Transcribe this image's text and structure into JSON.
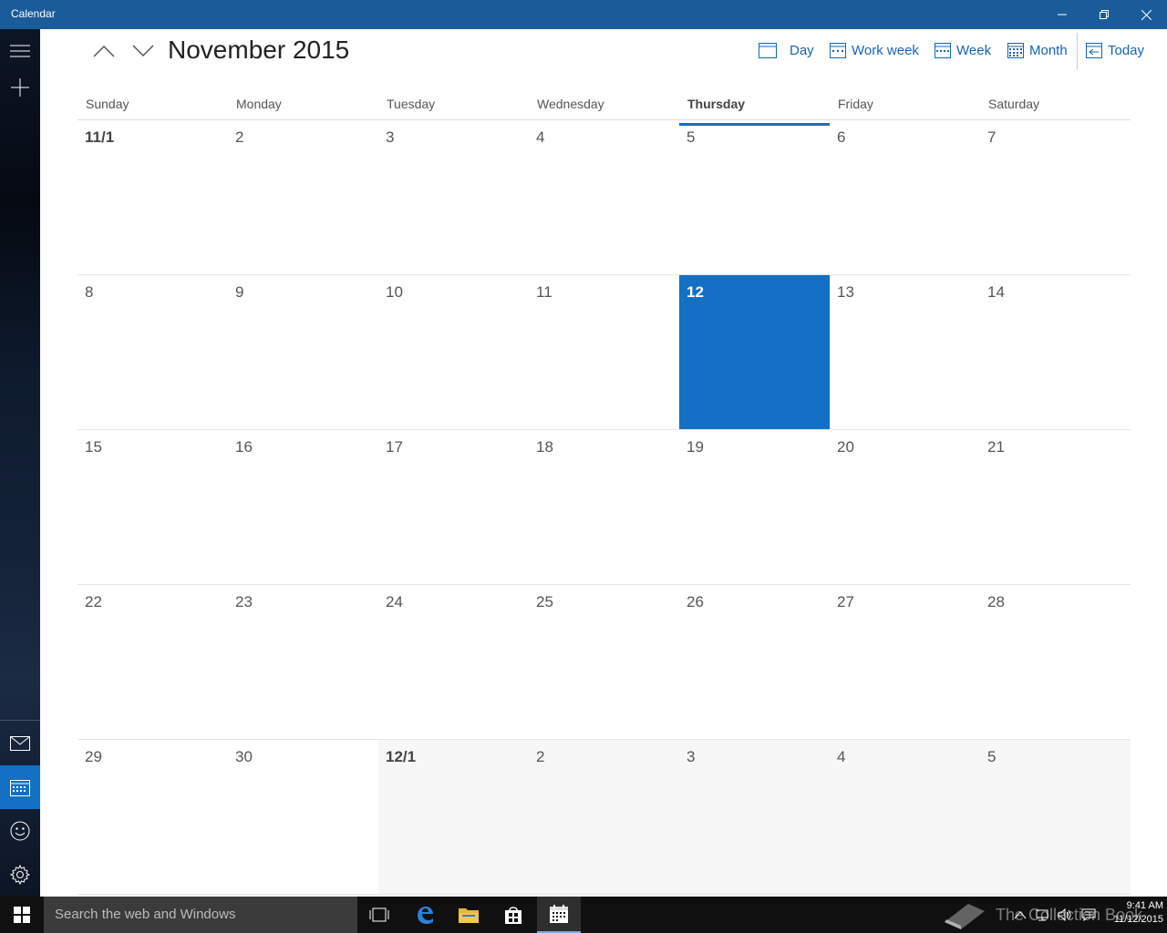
{
  "window": {
    "title": "Calendar"
  },
  "header": {
    "month_title": "November 2015",
    "views": [
      {
        "label": "Day",
        "icon": "day-view-icon"
      },
      {
        "label": "Work week",
        "icon": "workweek-view-icon"
      },
      {
        "label": "Week",
        "icon": "week-view-icon"
      },
      {
        "label": "Month",
        "icon": "month-view-icon"
      },
      {
        "label": "Today",
        "icon": "today-icon"
      }
    ]
  },
  "days_of_week": [
    "Sunday",
    "Monday",
    "Tuesday",
    "Wednesday",
    "Thursday",
    "Friday",
    "Saturday"
  ],
  "today_weekday_index": 4,
  "weeks": [
    [
      "11/1",
      "2",
      "3",
      "4",
      "5",
      "6",
      "7"
    ],
    [
      "8",
      "9",
      "10",
      "11",
      "12",
      "13",
      "14"
    ],
    [
      "15",
      "16",
      "17",
      "18",
      "19",
      "20",
      "21"
    ],
    [
      "22",
      "23",
      "24",
      "25",
      "26",
      "27",
      "28"
    ],
    [
      "29",
      "30",
      "12/1",
      "2",
      "3",
      "4",
      "5"
    ]
  ],
  "today_cell": {
    "week": 1,
    "day": 4
  },
  "other_month_start": {
    "week": 4,
    "day": 2
  },
  "taskbar": {
    "search_placeholder": "Search the web and Windows",
    "time": "9:41 AM",
    "date": "11/12/2015",
    "watermark": "The Collection Book"
  },
  "colors": {
    "accent": "#1470c4",
    "titlebar": "#1a5c99",
    "link": "#1565b0"
  }
}
